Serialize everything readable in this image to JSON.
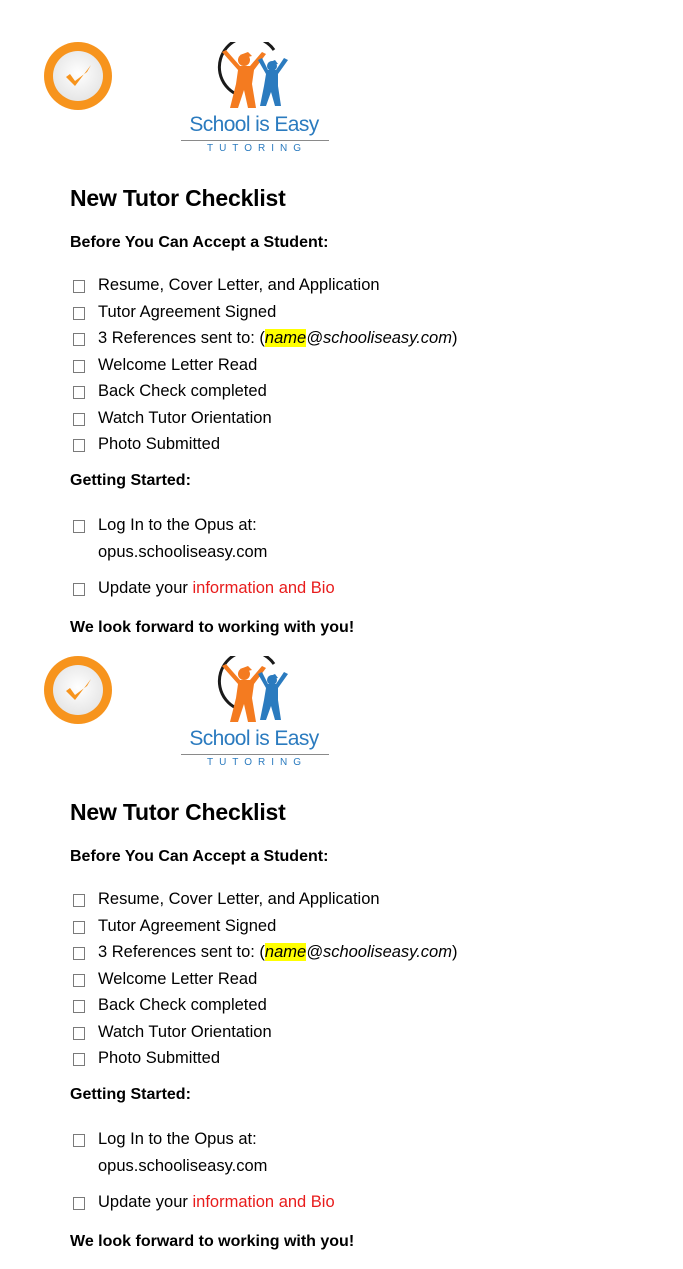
{
  "pages": [
    {
      "logo": {
        "name": "School is Easy",
        "tagline": "TUTORING"
      },
      "title": "New Tutor Checklist",
      "before_section": {
        "heading": "Before You Can Accept a Student:",
        "items": [
          {
            "label": "Resume, Cover Letter, and Application"
          },
          {
            "label": "Tutor Agreement Signed"
          },
          {
            "prefix": "3 References sent to: (",
            "highlight": "name",
            "email_rest": "@schooliseasy.com",
            "suffix": ")"
          },
          {
            "label": "Welcome Letter Read"
          },
          {
            "label": "Back Check completed"
          },
          {
            "label": "Watch Tutor Orientation"
          },
          {
            "label": "Photo Submitted"
          }
        ]
      },
      "getting_started": {
        "heading": "Getting Started:",
        "login_line1": "Log In to the Opus at:",
        "login_line2": "opus.schooliseasy.com",
        "update_prefix": "Update your ",
        "update_link": "information and Bio"
      },
      "closing": "We look forward to working with you!"
    },
    {
      "logo": {
        "name": "School is Easy",
        "tagline": "TUTORING"
      },
      "title": "New Tutor Checklist",
      "before_section": {
        "heading": "Before You Can Accept a Student:",
        "items": [
          {
            "label": "Resume, Cover Letter, and Application"
          },
          {
            "label": "Tutor Agreement Signed"
          },
          {
            "prefix": "3 References sent to: (",
            "highlight": "name",
            "email_rest": "@schooliseasy.com",
            "suffix": ")"
          },
          {
            "label": "Welcome Letter Read"
          },
          {
            "label": "Back Check completed"
          },
          {
            "label": "Watch Tutor Orientation"
          },
          {
            "label": "Photo Submitted"
          }
        ]
      },
      "getting_started": {
        "heading": "Getting Started:",
        "login_line1": "Log In to the Opus at:",
        "login_line2": "opus.schooliseasy.com",
        "update_prefix": "Update your ",
        "update_link": "information and Bio"
      },
      "closing": "We look forward to working with you!"
    }
  ],
  "colors": {
    "badge_orange": "#f7941d",
    "logo_blue": "#2b7bbf",
    "logo_orange": "#f47b20",
    "highlight": "#ffff00",
    "link_red": "#e81c1c"
  },
  "icons": {
    "badge": "checkmark-circle-icon",
    "checkbox": "empty-checkbox-icon"
  }
}
